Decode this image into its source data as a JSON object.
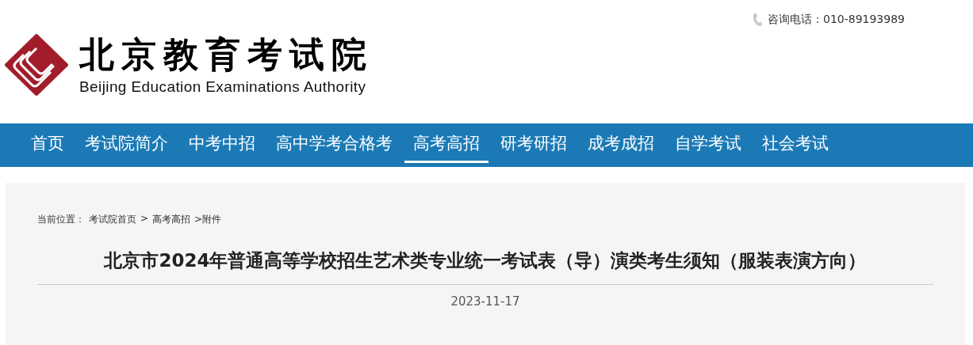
{
  "header": {
    "logo_title": "北京教育考试院",
    "logo_subtitle": "Beijing Education Examinations Authority",
    "phone": "咨询电话：010-89193989"
  },
  "nav": [
    {
      "label": "首页",
      "selected": false
    },
    {
      "label": "考试院简介",
      "selected": false
    },
    {
      "label": "中考中招",
      "selected": false
    },
    {
      "label": "高中学考合格考",
      "selected": false
    },
    {
      "label": "高考高招",
      "selected": true
    },
    {
      "label": "研考研招",
      "selected": false
    },
    {
      "label": "成考成招",
      "selected": false
    },
    {
      "label": "自学考试",
      "selected": false
    },
    {
      "label": "社会考试",
      "selected": false
    }
  ],
  "breadcrumb": {
    "label": "当前位置：",
    "items": [
      "考试院首页",
      ">",
      "高考高招",
      ">附件"
    ]
  },
  "article": {
    "title": "北京市2024年普通高等学校招生艺术类专业统一考试表（导）演类考生须知（服装表演方向）",
    "date": "2023-11-17"
  }
}
